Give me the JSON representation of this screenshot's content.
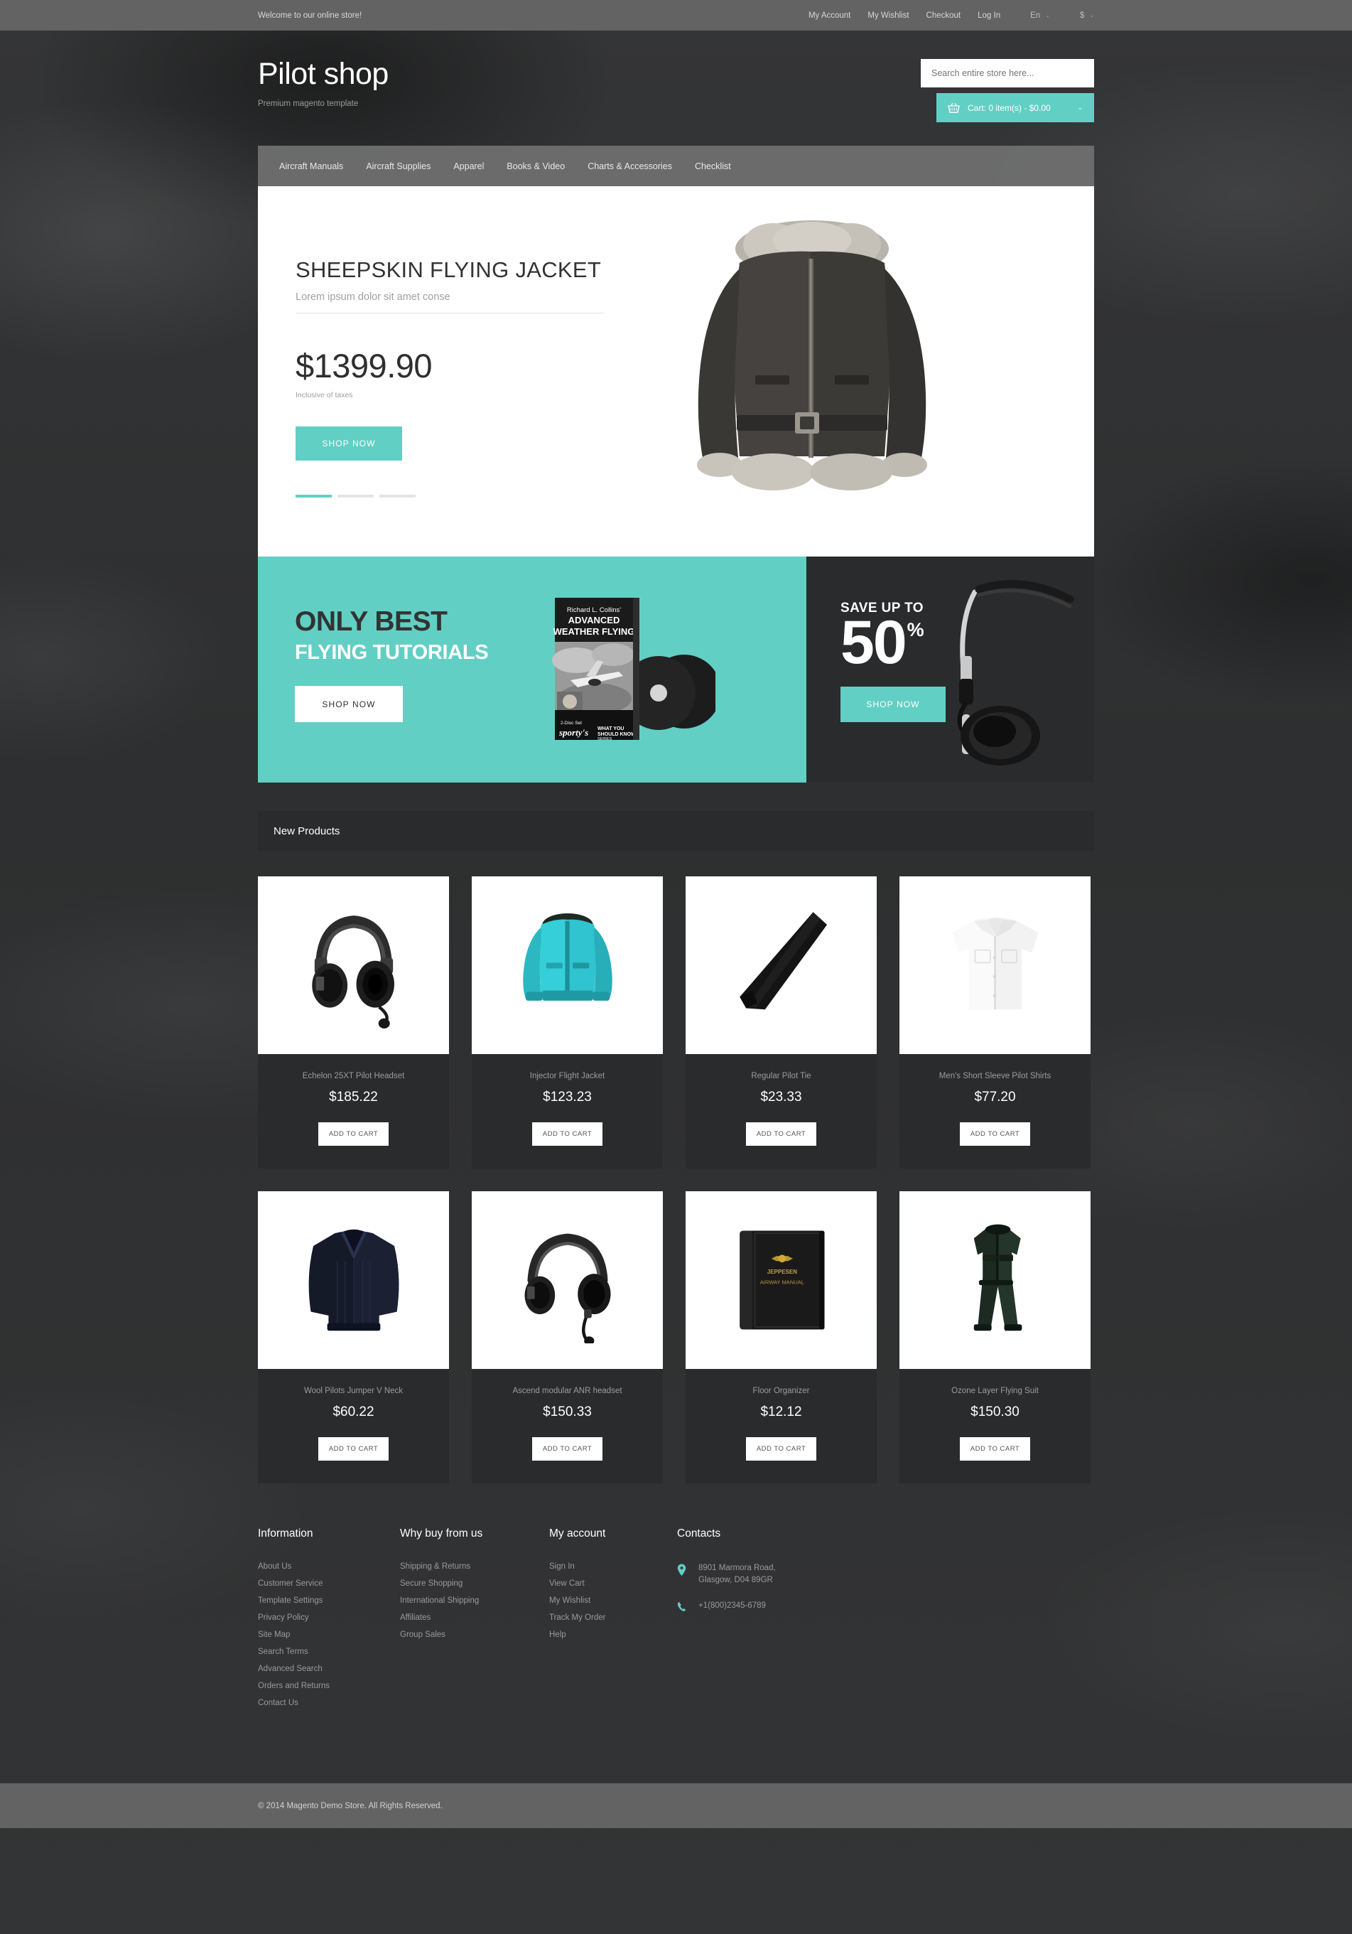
{
  "topbar": {
    "welcome": "Welcome to our online store!",
    "links": [
      "My Account",
      "My Wishlist",
      "Checkout",
      "Log In"
    ],
    "language": "En",
    "currency": "$",
    "caret_glyph": "⌄"
  },
  "header": {
    "logo": "Pilot shop",
    "tagline": "Premium magento template",
    "search_placeholder": "Search entire store here...",
    "cart_label": "Cart: 0 item(s) - $0.00",
    "cart_icon": "basket-icon",
    "cart_caret": "⌄"
  },
  "nav": {
    "items": [
      "Aircraft Manuals",
      "Aircraft Supplies",
      "Apparel",
      "Books & Video",
      "Charts & Accessories",
      "Checklist"
    ]
  },
  "slider": {
    "title": "SHEEPSKIN FLYING JACKET",
    "subtitle": "Lorem ipsum dolor sit amet conse",
    "price": "$1399.90",
    "tax_note": "Inclusive of taxes",
    "button": "SHOP NOW",
    "dots": 3,
    "active_dot": 0,
    "image_alt": "sheepskin-flying-jacket"
  },
  "promo_left": {
    "heading_1": "ONLY BEST",
    "heading_2": "FLYING TUTORIALS",
    "button": "SHOP NOW",
    "bg_color": "#62cfc4",
    "dvd": {
      "author": "Richard L. Collins'",
      "title_1": "ADVANCED",
      "title_2": "WEATHER FLYING",
      "brand": "sporty's",
      "series_1": "WHAT YOU",
      "series_2": "SHOULD KNOW",
      "series_3": "SERIES",
      "disc_note": "2-Disc Set"
    }
  },
  "promo_right": {
    "heading": "SAVE UP TO",
    "amount": "50",
    "percent": "%",
    "button": "SHOP NOW",
    "bg_color": "#2a2b2c",
    "image_alt": "headphones"
  },
  "new_products": {
    "section_title": "New Products",
    "add_to_cart_label": "ADD TO CART",
    "items": [
      {
        "name": "Echelon 25XT Pilot Headset",
        "price": "$185.22",
        "image": "pilot-headset"
      },
      {
        "name": "Injector Flight Jacket",
        "price": "$123.23",
        "image": "flight-jacket"
      },
      {
        "name": "Regular Pilot Tie",
        "price": "$23.33",
        "image": "pilot-tie"
      },
      {
        "name": "Men's Short Sleeve Pilot Shirts",
        "price": "$77.20",
        "image": "pilot-shirt"
      },
      {
        "name": "Wool Pilots Jumper V Neck",
        "price": "$60.22",
        "image": "wool-jumper"
      },
      {
        "name": "Ascend modular ANR headset",
        "price": "$150.33",
        "image": "anr-headset"
      },
      {
        "name": "Floor Organizer",
        "price": "$12.12",
        "image": "binder-organizer"
      },
      {
        "name": "Ozone Layer Flying Suit",
        "price": "$150.30",
        "image": "flying-suit"
      }
    ]
  },
  "footer": {
    "col_information": {
      "heading": "Information",
      "links": [
        "About Us",
        "Customer Service",
        "Template Settings",
        "Privacy Policy",
        "Site Map",
        "Search Terms",
        "Advanced Search",
        "Orders and Returns",
        "Contact Us"
      ]
    },
    "col_why": {
      "heading": "Why buy from us",
      "links": [
        "Shipping & Returns",
        "Secure Shopping",
        "International Shipping",
        "Affiliates",
        "Group Sales"
      ]
    },
    "col_account": {
      "heading": "My account",
      "links": [
        "Sign In",
        "View Cart",
        "My Wishlist",
        "Track My Order",
        "Help"
      ]
    },
    "col_contacts": {
      "heading": "Contacts",
      "address_line_1": "8901 Marmora Road,",
      "address_line_2": "Glasgow, D04 89GR",
      "phone": "+1(800)2345-6789",
      "pin_icon": "map-pin-icon",
      "phone_icon": "phone-icon",
      "icon_color": "#62cfc4"
    }
  },
  "copyright": "© 2014 Magento Demo Store. All Rights Reserved.",
  "theme": {
    "accent": "#62cfc4",
    "dark_panel": "#2a2b2c",
    "bar_gray": "#636363",
    "nav_gray": "#707070"
  }
}
